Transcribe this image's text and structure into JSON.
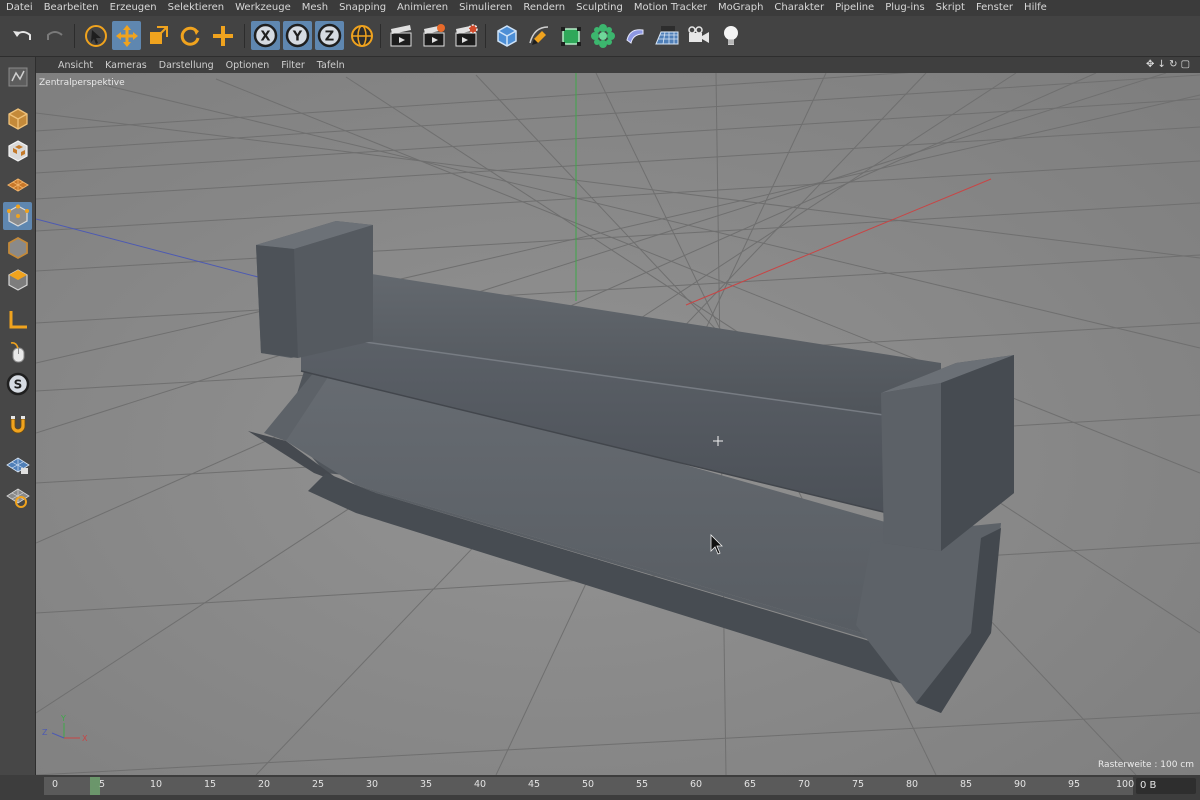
{
  "menubar": {
    "items": [
      "Datei",
      "Bearbeiten",
      "Erzeugen",
      "Selektieren",
      "Werkzeuge",
      "Mesh",
      "Snapping",
      "Animieren",
      "Simulieren",
      "Rendern",
      "Sculpting",
      "Motion Tracker",
      "MoGraph",
      "Charakter",
      "Pipeline",
      "Plug-ins",
      "Skript",
      "Fenster",
      "Hilfe"
    ]
  },
  "toolbar": {
    "axis_x": "X",
    "axis_y": "Y",
    "axis_z": "Z"
  },
  "viewport": {
    "menu": [
      "Ansicht",
      "Kameras",
      "Darstellung",
      "Optionen",
      "Filter",
      "Tafeln"
    ],
    "camera_label": "Zentralperspektive",
    "grid_spacing": "Rasterweite : 100 cm",
    "nav_controls": "✥ ↓ ↻ ▢",
    "axis_y_label": "Y",
    "axis_z_label": "Z",
    "axis_x_label": "X"
  },
  "timeline": {
    "ticks": [
      "0",
      "5",
      "10",
      "15",
      "20",
      "25",
      "30",
      "35",
      "40",
      "45",
      "50",
      "55",
      "60",
      "65",
      "70",
      "75",
      "80",
      "85",
      "90",
      "95",
      "100"
    ],
    "current_frame": "0 B"
  },
  "colors": {
    "accent": "#5f87b0",
    "tool_orange": "#f0a31e",
    "axis_x": "#c84545",
    "axis_y": "#3fa84a",
    "axis_z": "#4d5ab2"
  }
}
